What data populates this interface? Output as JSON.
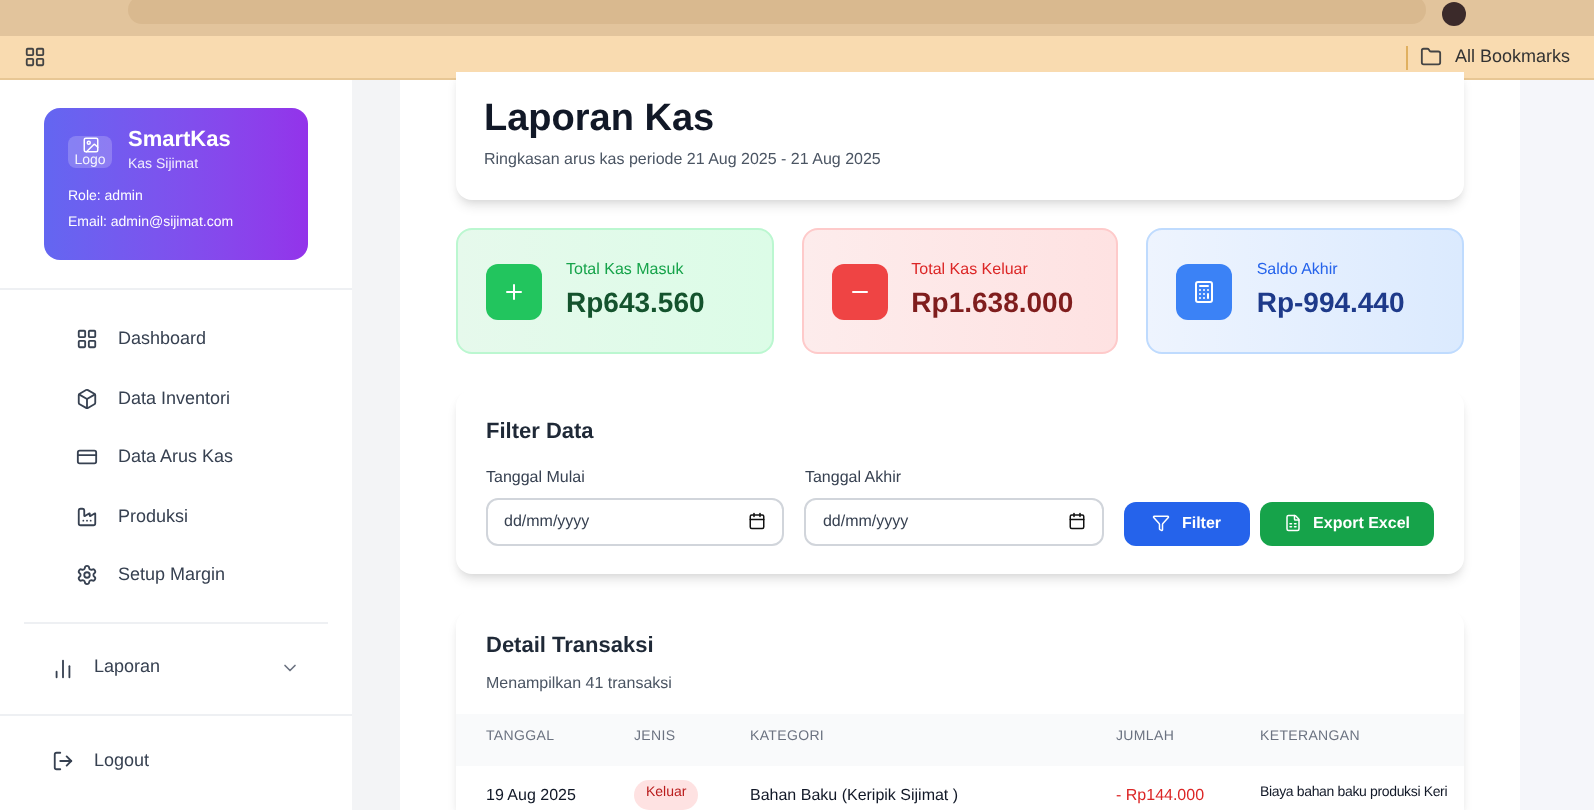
{
  "browser": {
    "bookmarks_label": "All Bookmarks"
  },
  "sidebar": {
    "brand": {
      "logo_alt": "Logo",
      "name": "SmartKas",
      "subtitle": "Kas Sijimat",
      "role": "Role: admin",
      "email": "Email: admin@sijimat.com"
    },
    "items": [
      {
        "kind": "dashboard",
        "label": "Dashboard"
      },
      {
        "kind": "inventory",
        "label": "Data Inventori"
      },
      {
        "kind": "cash",
        "label": "Data Arus Kas"
      },
      {
        "kind": "production",
        "label": "Produksi"
      },
      {
        "kind": "margin",
        "label": "Setup Margin"
      }
    ],
    "group": {
      "label": "Laporan",
      "expanded": false
    },
    "logout": "Logout"
  },
  "header": {
    "title": "Laporan Kas",
    "subtitle": "Ringkasan arus kas periode 21 Aug 2025 - 21 Aug 2025"
  },
  "stats": [
    {
      "kind": "in",
      "label": "Total Kas Masuk",
      "value": "Rp643.560"
    },
    {
      "kind": "out",
      "label": "Total Kas Keluar",
      "value": "Rp1.638.000"
    },
    {
      "kind": "balance",
      "label": "Saldo Akhir",
      "value": "Rp-994.440"
    }
  ],
  "filter": {
    "title": "Filter Data",
    "fields": [
      {
        "label": "Tanggal Mulai",
        "placeholder": "dd/mm/yyyy"
      },
      {
        "label": "Tanggal Akhir",
        "placeholder": "dd/mm/yyyy"
      }
    ],
    "filter_button": "Filter",
    "export_button": "Export Excel"
  },
  "details": {
    "title": "Detail Transaksi",
    "subtitle": "Menampilkan 41 transaksi",
    "columns": [
      "TANGGAL",
      "JENIS",
      "KATEGORI",
      "JUMLAH",
      "KETERANGAN"
    ],
    "rows": [
      {
        "date": "19 Aug 2025",
        "kind": "out",
        "kind_label": "Keluar",
        "category": "Bahan Baku (Keripik Sijimat )",
        "amount": "- Rp144.000",
        "note": "Biaya bahan baku produksi Keri"
      }
    ]
  }
}
